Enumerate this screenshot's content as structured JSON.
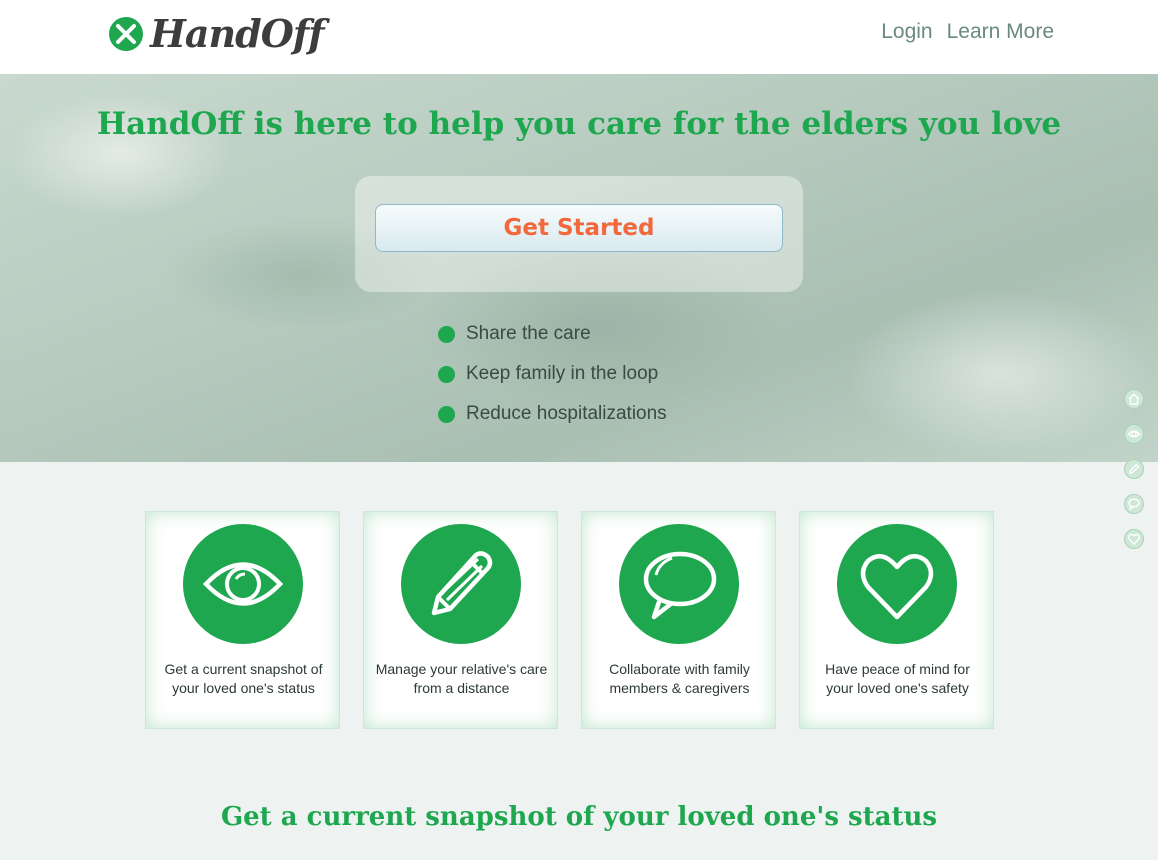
{
  "header": {
    "logo_text": "HandOff",
    "nav": [
      {
        "label": "Login"
      },
      {
        "label": "Learn More"
      }
    ]
  },
  "hero": {
    "title": "HandOff is here to help you care for the elders you love",
    "cta_label": "Get Started",
    "bullets": [
      {
        "text": "Share the care"
      },
      {
        "text": "Keep family in the loop"
      },
      {
        "text": "Reduce hospitalizations"
      }
    ]
  },
  "side_nav": {
    "icons": [
      "home-icon",
      "eye-icon",
      "pencil-icon",
      "chat-bubble-icon",
      "heart-icon"
    ]
  },
  "features": {
    "cards": [
      {
        "icon": "eye-icon",
        "text": "Get a current snapshot of your loved one's status"
      },
      {
        "icon": "pencil-icon",
        "text": "Manage your relative's care from a distance"
      },
      {
        "icon": "chat-bubble-icon",
        "text": "Collaborate with family members & caregivers"
      },
      {
        "icon": "heart-icon",
        "text": "Have peace of mind for your loved one's safety"
      }
    ]
  },
  "section": {
    "title": "Get a current snapshot of your loved one's status"
  },
  "colors": {
    "brand_green": "#1fa750",
    "cta_text": "#f2683c",
    "nav_text": "#6a8a7d"
  }
}
